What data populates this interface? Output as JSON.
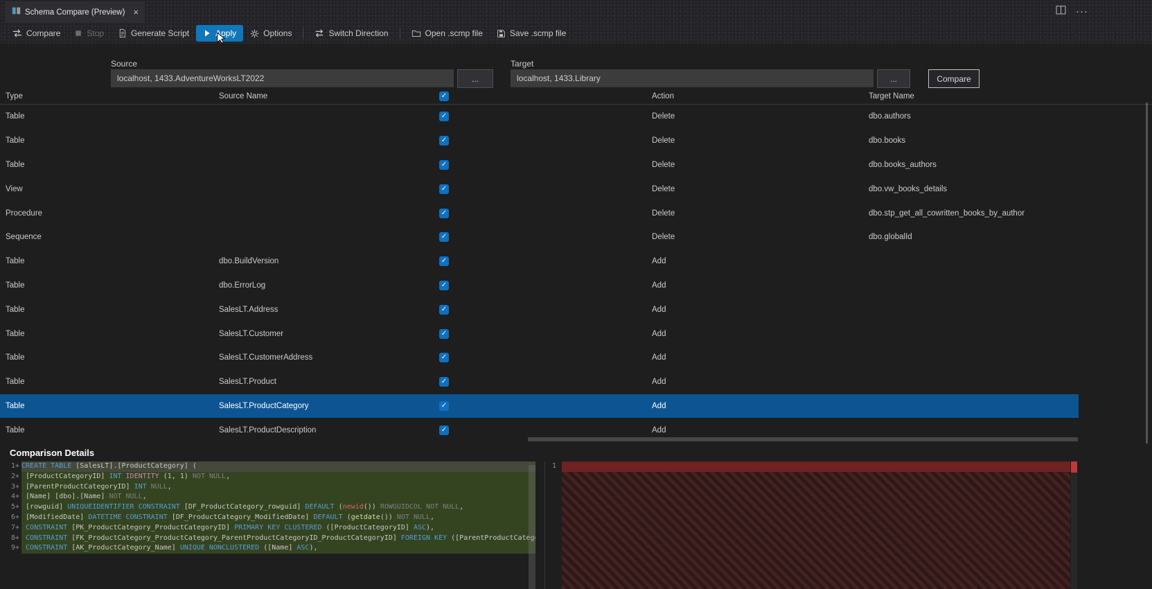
{
  "tab_bar": {
    "title": "Schema Compare (Preview)",
    "close": "×",
    "more_icon": "···"
  },
  "toolbar": {
    "items": [
      {
        "id": "compare",
        "label": "Compare",
        "icon": "compare-icon",
        "state": "normal"
      },
      {
        "id": "stop",
        "label": "Stop",
        "icon": "stop-icon",
        "state": "disabled"
      },
      {
        "id": "generate-script",
        "label": "Generate Script",
        "icon": "generate-script-icon",
        "state": "normal"
      },
      {
        "id": "apply",
        "label": "Apply",
        "icon": "apply-play-icon",
        "state": "active"
      },
      {
        "id": "options",
        "label": "Options",
        "icon": "options-gear-icon",
        "state": "normal"
      },
      {
        "id": "switch-direction",
        "label": "Switch Direction",
        "icon": "switch-direction-icon",
        "state": "normal",
        "sep_before": true
      },
      {
        "id": "open-scmp",
        "label": "Open .scmp file",
        "icon": "open-file-icon",
        "state": "normal",
        "sep_before": true
      },
      {
        "id": "save-scmp",
        "label": "Save .scmp file",
        "icon": "save-file-icon",
        "state": "normal"
      }
    ]
  },
  "connections": {
    "source_label": "Source",
    "source_value": "localhost, 1433.AdventureWorksLT2022",
    "target_label": "Target",
    "target_value": "localhost, 1433.Library",
    "ellipsis": "...",
    "compare_button": "Compare"
  },
  "grid": {
    "columns": {
      "type": "Type",
      "source": "Source Name",
      "action": "Action",
      "target": "Target Name"
    },
    "header_checkbox_checked": true,
    "check_glyph": "✓",
    "rows": [
      {
        "type": "Table",
        "source": "",
        "action": "Delete",
        "target": "dbo.authors",
        "checked": true
      },
      {
        "type": "Table",
        "source": "",
        "action": "Delete",
        "target": "dbo.books",
        "checked": true
      },
      {
        "type": "Table",
        "source": "",
        "action": "Delete",
        "target": "dbo.books_authors",
        "checked": true
      },
      {
        "type": "View",
        "source": "",
        "action": "Delete",
        "target": "dbo.vw_books_details",
        "checked": true
      },
      {
        "type": "Procedure",
        "source": "",
        "action": "Delete",
        "target": "dbo.stp_get_all_cowritten_books_by_author",
        "checked": true
      },
      {
        "type": "Sequence",
        "source": "",
        "action": "Delete",
        "target": "dbo.globalId",
        "checked": true
      },
      {
        "type": "Table",
        "source": "dbo.BuildVersion",
        "action": "Add",
        "target": "",
        "checked": true
      },
      {
        "type": "Table",
        "source": "dbo.ErrorLog",
        "action": "Add",
        "target": "",
        "checked": true
      },
      {
        "type": "Table",
        "source": "SalesLT.Address",
        "action": "Add",
        "target": "",
        "checked": true
      },
      {
        "type": "Table",
        "source": "SalesLT.Customer",
        "action": "Add",
        "target": "",
        "checked": true
      },
      {
        "type": "Table",
        "source": "SalesLT.CustomerAddress",
        "action": "Add",
        "target": "",
        "checked": true
      },
      {
        "type": "Table",
        "source": "SalesLT.Product",
        "action": "Add",
        "target": "",
        "checked": true
      },
      {
        "type": "Table",
        "source": "SalesLT.ProductCategory",
        "action": "Add",
        "target": "",
        "checked": true,
        "selected": true
      },
      {
        "type": "Table",
        "source": "SalesLT.ProductDescription",
        "action": "Add",
        "target": "",
        "checked": true
      }
    ]
  },
  "details": {
    "title": "Comparison Details",
    "left": {
      "lines": [
        {
          "n": "1",
          "marker": "+",
          "tokens": [
            [
              "k",
              "CREATE TABLE"
            ],
            [
              "d",
              " [SalesLT].[ProductCategory] ("
            ]
          ]
        },
        {
          "n": "2",
          "marker": "+",
          "tokens": [
            [
              "d",
              " [ProductCategoryID] "
            ],
            [
              "k",
              "INT"
            ],
            [
              "d",
              " "
            ],
            [
              "m",
              "IDENTITY"
            ],
            [
              "d",
              " ("
            ],
            [
              "n",
              "1"
            ],
            [
              "d",
              ", "
            ],
            [
              "n",
              "1"
            ],
            [
              "d",
              ") "
            ],
            [
              "g",
              "NOT NULL"
            ],
            [
              "d",
              ","
            ]
          ]
        },
        {
          "n": "3",
          "marker": "+",
          "tokens": [
            [
              "d",
              " [ParentProductCategoryID] "
            ],
            [
              "k",
              "INT"
            ],
            [
              "d",
              " "
            ],
            [
              "g",
              "NULL"
            ],
            [
              "d",
              ","
            ]
          ]
        },
        {
          "n": "4",
          "marker": "+",
          "tokens": [
            [
              "d",
              " [Name] [dbo].[Name] "
            ],
            [
              "g",
              "NOT NULL"
            ],
            [
              "d",
              ","
            ]
          ]
        },
        {
          "n": "5",
          "marker": "+",
          "tokens": [
            [
              "d",
              " [rowguid] "
            ],
            [
              "k",
              "UNIQUEIDENTIFIER"
            ],
            [
              "d",
              " "
            ],
            [
              "k",
              "CONSTRAINT"
            ],
            [
              "d",
              " [DF_ProductCategory_rowguid] "
            ],
            [
              "k",
              "DEFAULT"
            ],
            [
              "d",
              " ("
            ],
            [
              "r",
              "newid"
            ],
            [
              "d",
              "()) "
            ],
            [
              "g",
              "ROWGUIDCOL NOT NULL"
            ],
            [
              "d",
              ","
            ]
          ]
        },
        {
          "n": "6",
          "marker": "+",
          "tokens": [
            [
              "d",
              " [ModifiedDate] "
            ],
            [
              "k",
              "DATETIME"
            ],
            [
              "d",
              " "
            ],
            [
              "k",
              "CONSTRAINT"
            ],
            [
              "d",
              " [DF_ProductCategory_ModifiedDate] "
            ],
            [
              "k",
              "DEFAULT"
            ],
            [
              "d",
              " ("
            ],
            [
              "y",
              "getdate"
            ],
            [
              "d",
              "()) "
            ],
            [
              "g",
              "NOT NULL"
            ],
            [
              "d",
              ","
            ]
          ]
        },
        {
          "n": "7",
          "marker": "+",
          "tokens": [
            [
              "d",
              " "
            ],
            [
              "k",
              "CONSTRAINT"
            ],
            [
              "d",
              " [PK_ProductCategory_ProductCategoryID] "
            ],
            [
              "k",
              "PRIMARY KEY CLUSTERED"
            ],
            [
              "d",
              " ([ProductCategoryID] "
            ],
            [
              "k",
              "ASC"
            ],
            [
              "d",
              "),"
            ]
          ]
        },
        {
          "n": "8",
          "marker": "+",
          "tokens": [
            [
              "d",
              " "
            ],
            [
              "k",
              "CONSTRAINT"
            ],
            [
              "d",
              " [FK_ProductCategory_ProductCategory_ParentProductCategoryID_ProductCategoryID] "
            ],
            [
              "k",
              "FOREIGN KEY"
            ],
            [
              "d",
              " ([ParentProductCatego"
            ]
          ]
        },
        {
          "n": "9",
          "marker": "+",
          "tokens": [
            [
              "d",
              " "
            ],
            [
              "k",
              "CONSTRAINT"
            ],
            [
              "d",
              " [AK_ProductCategory_Name] "
            ],
            [
              "k",
              "UNIQUE NONCLUSTERED"
            ],
            [
              "d",
              " ([Name] "
            ],
            [
              "k",
              "ASC"
            ],
            [
              "d",
              "),"
            ]
          ]
        }
      ]
    },
    "right": {
      "line_number": "1"
    }
  },
  "colors": {
    "accent": "#1177bb",
    "selection": "#0d5592",
    "checkbox": "#0e70c0",
    "add_bg": "#354420",
    "add_first_bg": "#45493b",
    "remove_strip": "#6e2222",
    "hatch_light": "#432222",
    "hatch_dark": "#2e1717"
  }
}
